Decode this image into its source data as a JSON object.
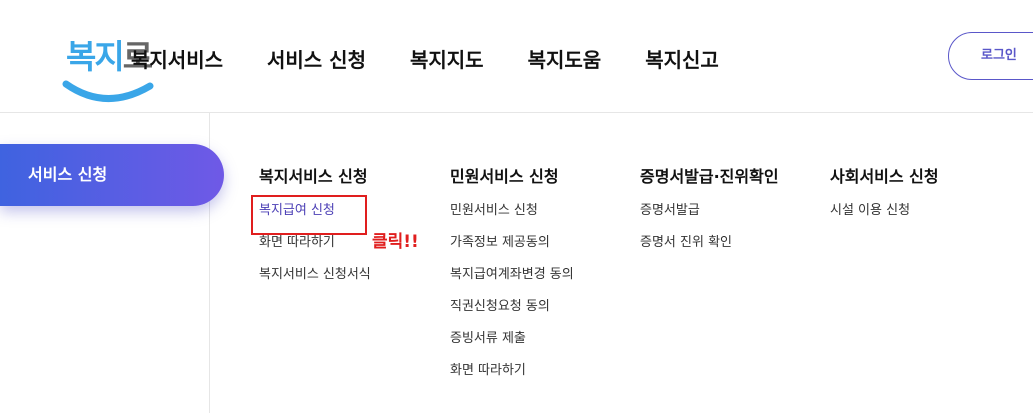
{
  "top_cut_text": "",
  "logo": {
    "part1": "복지",
    "part2": "로"
  },
  "gnb": [
    "복지서비스",
    "서비스 신청",
    "복지지도",
    "복지도움",
    "복지신고"
  ],
  "login_label": "로그인",
  "side_active": "서비스 신청",
  "columns": [
    {
      "title": "복지서비스 신청",
      "links": [
        "복지급여 신청",
        "화면 따라하기",
        "복지서비스 신청서식"
      ]
    },
    {
      "title": "민원서비스 신청",
      "links": [
        "민원서비스 신청",
        "가족정보 제공동의",
        "복지급여계좌변경 동의",
        "직권신청요청 동의",
        "증빙서류 제출",
        "화면 따라하기"
      ]
    },
    {
      "title": "증명서발급·진위확인",
      "links": [
        "증명서발급",
        "증명서 진위 확인"
      ]
    },
    {
      "title": "사회서비스 신청",
      "links": [
        "시설 이용 신청"
      ]
    }
  ],
  "annotation_text": "클릭!!",
  "colors": {
    "accent": "#5a57c9",
    "annotation": "#e01e1e",
    "gradient_start": "#3f63e0",
    "gradient_end": "#6f59e6"
  }
}
